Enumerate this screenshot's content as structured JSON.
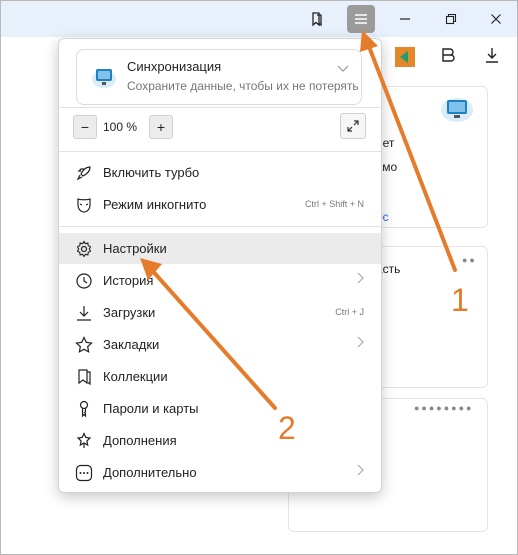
{
  "window": {
    "bookmark_icon": "bookmarks-icon",
    "menu_icon": "hamburger-menu-icon",
    "minimize_icon": "minimize-icon",
    "restore_icon": "restore-icon",
    "close_icon": "close-icon"
  },
  "background": {
    "card1_line1": "нет",
    "card1_line2": "ьмо",
    "card1_link": "ос",
    "card2_text": "асть",
    "accent_link_color": "#2a6bd6"
  },
  "menu": {
    "sync": {
      "title": "Синхронизация",
      "subtitle": "Сохраните данные, чтобы их не потерять"
    },
    "zoom": {
      "minus": "−",
      "value": "100 %",
      "plus": "+"
    },
    "items": [
      {
        "label": "Включить турбо",
        "icon": "rocket-icon",
        "shortcut": ""
      },
      {
        "label": "Режим инкогнито",
        "icon": "incognito-mask-icon",
        "shortcut": "Ctrl + Shift + N"
      },
      {
        "label": "Настройки",
        "icon": "gear-icon",
        "shortcut": ""
      },
      {
        "label": "История",
        "icon": "clock-icon",
        "shortcut": ""
      },
      {
        "label": "Загрузки",
        "icon": "download-icon",
        "shortcut": "Ctrl + J"
      },
      {
        "label": "Закладки",
        "icon": "star-icon",
        "shortcut": ""
      },
      {
        "label": "Коллекции",
        "icon": "collections-icon",
        "shortcut": ""
      },
      {
        "label": "Пароли и карты",
        "icon": "key-icon",
        "shortcut": ""
      },
      {
        "label": "Дополнения",
        "icon": "puzzle-icon",
        "shortcut": ""
      },
      {
        "label": "Дополнительно",
        "icon": "more-dots-icon",
        "shortcut": ""
      }
    ]
  },
  "annotations": {
    "label1": "1",
    "label2": "2",
    "color": "#e47c2c"
  }
}
